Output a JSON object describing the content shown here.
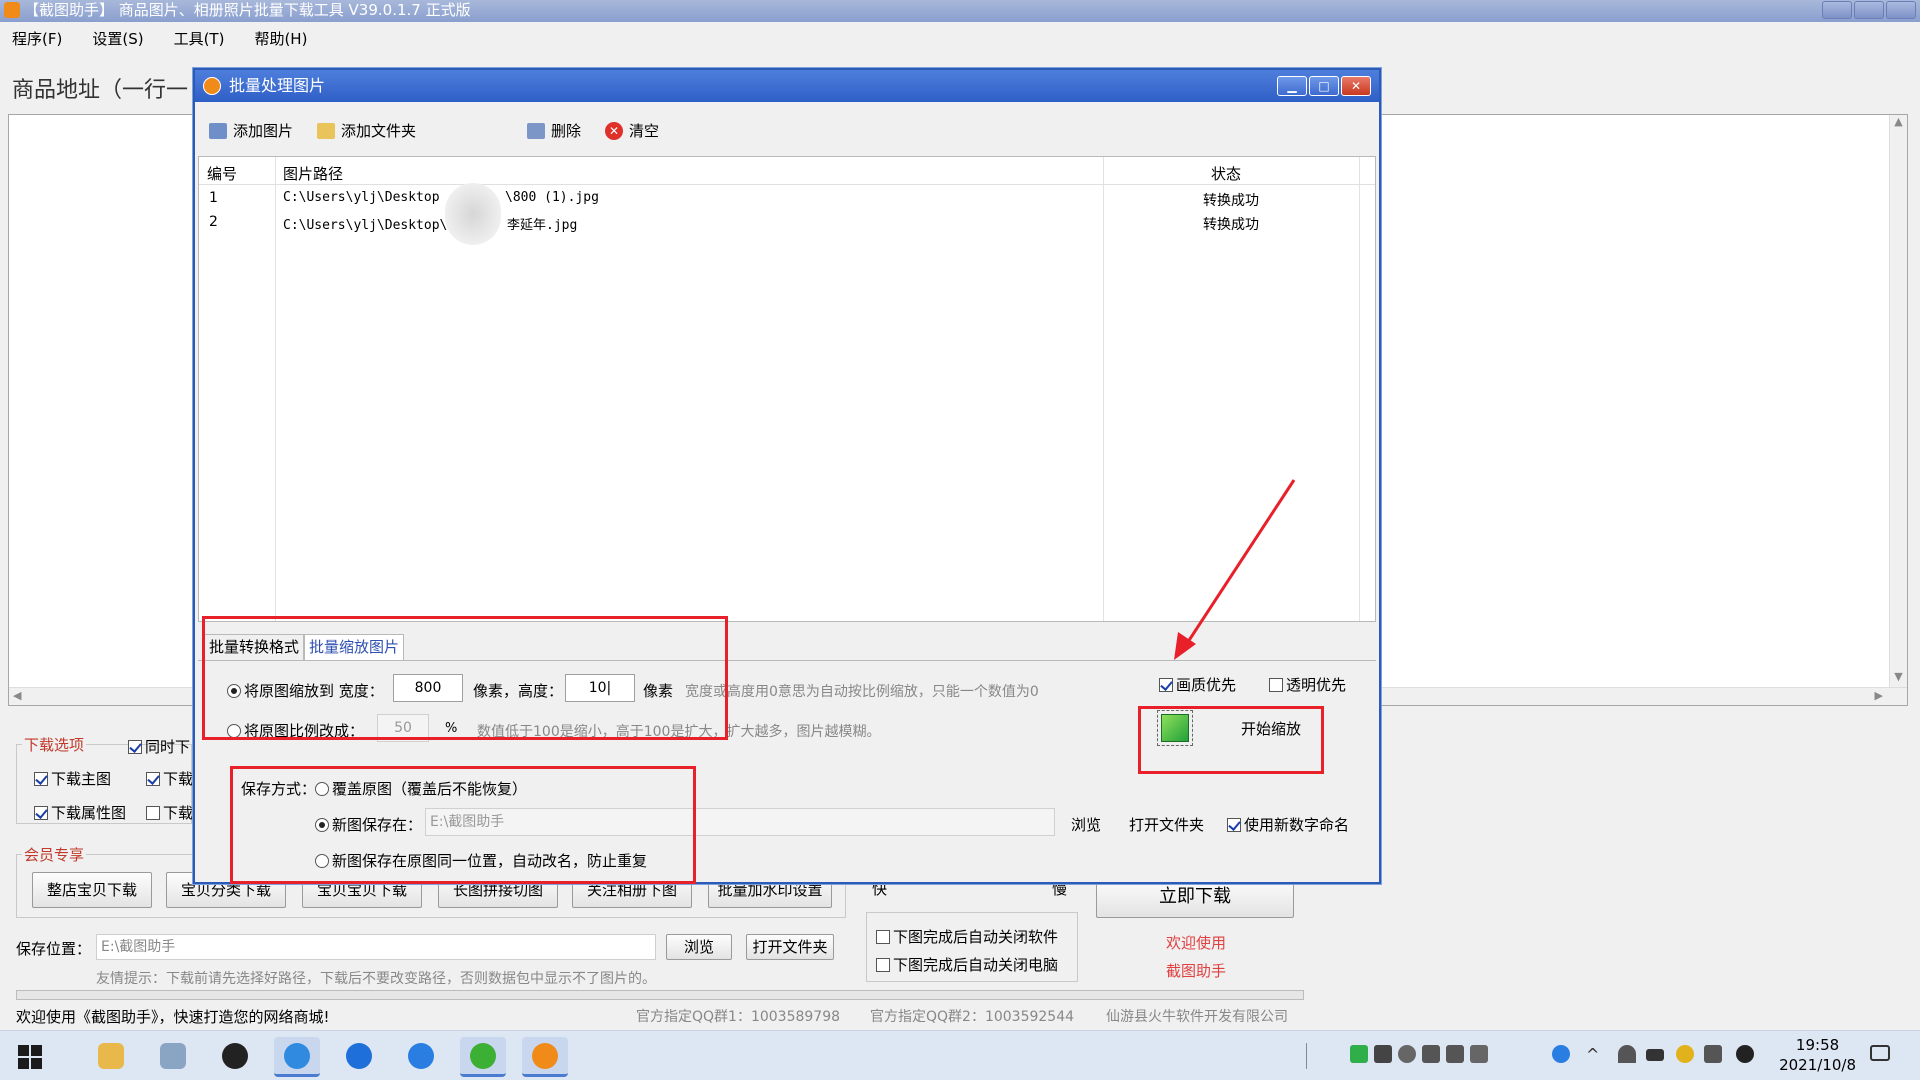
{
  "main": {
    "title": "【截图助手】 商品图片、相册照片批量下载工具 V39.0.1.7 正式版",
    "menu": [
      "程序(F)",
      "设置(S)",
      "工具(T)",
      "帮助(H)"
    ],
    "url_label": "商品地址（一行一",
    "download_options": {
      "group_label": "下载选项",
      "items": [
        {
          "label": "同时下",
          "checked": true
        },
        {
          "label": "下载主图",
          "checked": true
        },
        {
          "label": "下载",
          "checked": true
        },
        {
          "label": "下载属性图",
          "checked": true
        },
        {
          "label": "下载",
          "checked": false
        }
      ]
    },
    "member": {
      "group_label": "会员专享",
      "buttons": [
        "整店宝贝下载",
        "宝贝分类下载",
        "宝贝宝贝下载",
        "长图拼接切图",
        "关注相册下图",
        "批量加水印设置"
      ]
    },
    "speed": {
      "fast": "快",
      "slow": "慢"
    },
    "start_download_label": "立即下载",
    "after_options": [
      {
        "label": "下图完成后自动关闭软件",
        "checked": false
      },
      {
        "label": "下图完成后自动关闭电脑",
        "checked": false
      }
    ],
    "welcome_lines": [
      "欢迎使用",
      "截图助手"
    ],
    "save_location_label": "保存位置：",
    "save_location_value": "E:\\截图助手",
    "browse_label": "浏览",
    "open_folder_label": "打开文件夹",
    "tip": "友情提示：下载前请先选择好路径，下载后不要改变路径，否则数据包中显示不了图片的。",
    "status_welcome": "欢迎使用《截图助手》，快速打造您的网络商城!",
    "qq_group_1": "官方指定QQ群1：1003589798",
    "qq_group_2": "官方指定QQ群2：1003592544",
    "company": "仙游县火牛软件开发有限公司"
  },
  "dialog": {
    "title": "批量处理图片",
    "toolbar": {
      "add_image": "添加图片",
      "add_folder": "添加文件夹",
      "delete": "删除",
      "clear": "清空"
    },
    "table": {
      "columns": [
        "编号",
        "图片路径",
        "状态"
      ],
      "rows": [
        {
          "no": "1",
          "path_a": "C:\\Users\\ylj\\Desktop",
          "path_b": "\\800 (1).jpg",
          "status": "转换成功"
        },
        {
          "no": "2",
          "path_a": "C:\\Users\\ylj\\Desktop\\看",
          "path_b": "李延年.jpg",
          "status": "转换成功"
        }
      ]
    },
    "tabs": [
      "批量转换格式",
      "批量缩放图片"
    ],
    "active_tab": "批量缩放图片",
    "resize": {
      "scale_to_label": "将原图缩放到 宽度：",
      "width_value": "800",
      "px_height_label": "像素，高度：",
      "height_value": "10|",
      "px_label": "像素",
      "scale_hint": "宽度或高度用0意思为自动按比例缩放，只能一个数值为0",
      "ratio_label": "将原图比例改成：",
      "ratio_value": "50",
      "percent": "%",
      "ratio_hint": "数值低于100是缩小，高于100是扩大，扩大越多，图片越模糊。"
    },
    "quality_first": {
      "label": "画质优先",
      "checked": true
    },
    "transparent_first": {
      "label": "透明优先",
      "checked": false
    },
    "start_scale_label": "开始缩放",
    "save": {
      "mode_label": "保存方式：",
      "overwrite_label": "覆盖原图（覆盖后不能恢复）",
      "new_save_label": "新图保存在：",
      "new_save_path": "E:\\截图助手",
      "same_place_label": "新图保存在原图同一位置，自动改名，防止重复",
      "browse_label": "浏览",
      "open_folder_label": "打开文件夹",
      "numeric_rename": {
        "label": "使用新数字命名",
        "checked": true
      }
    }
  },
  "taskbar": {
    "time": "19:58",
    "date": "2021/10/8"
  },
  "colors": {
    "dialog_border": "#2c5bb5",
    "highlight_red": "#e8202a",
    "accent_blue": "#2d4fb0"
  }
}
